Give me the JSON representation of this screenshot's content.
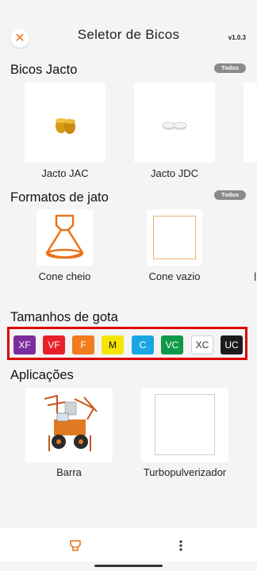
{
  "header": {
    "title": "Seletor de Bicos",
    "version": "v1.0.3",
    "close_icon": "close-icon"
  },
  "sections": {
    "nozzles": {
      "title": "Bicos Jacto",
      "filter_label": "Todos",
      "items": [
        {
          "label": "Jacto JAC"
        },
        {
          "label": "Jacto JDC"
        }
      ]
    },
    "jet_formats": {
      "title": "Formatos de jato",
      "filter_label": "Todos",
      "items": [
        {
          "label": "Cone cheio"
        },
        {
          "label": "Cone vazio"
        }
      ]
    },
    "drop_sizes": {
      "title": "Tamanhos de gota",
      "chips": [
        {
          "label": "XF",
          "bg": "#7b2d9e",
          "fg": "#ffffff"
        },
        {
          "label": "VF",
          "bg": "#e8202a",
          "fg": "#ffffff"
        },
        {
          "label": "F",
          "bg": "#f07c1c",
          "fg": "#ffffff"
        },
        {
          "label": "M",
          "bg": "#f5e400",
          "fg": "#111111"
        },
        {
          "label": "C",
          "bg": "#1aa6e0",
          "fg": "#ffffff"
        },
        {
          "label": "VC",
          "bg": "#0f9a49",
          "fg": "#ffffff"
        },
        {
          "label": "XC",
          "bg": "#ffffff",
          "fg": "#333333"
        },
        {
          "label": "UC",
          "bg": "#1c1c1c",
          "fg": "#ffffff"
        }
      ]
    },
    "applications": {
      "title": "Aplicações",
      "items": [
        {
          "label": "Barra"
        },
        {
          "label": "Turbopulverizador"
        }
      ]
    }
  },
  "colors": {
    "accent": "#e8731a",
    "highlight": "#e00000"
  },
  "bottom_nav": {
    "left_icon": "nozzle-icon",
    "right_icon": "more-vert-icon"
  }
}
